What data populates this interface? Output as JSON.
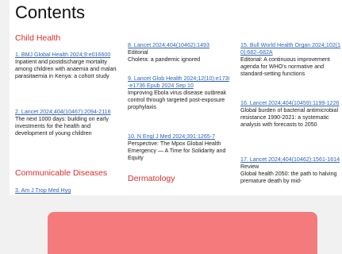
{
  "page": {
    "title": "Contents",
    "columns": [
      {
        "blocks": [
          {
            "kind": "heading",
            "text": "Child Health"
          },
          {
            "kind": "entry",
            "ref": "1. BMJ Global Health 2024;9:e016600",
            "type": "",
            "title": "Inpatient and postdischarge mortality among children with anaemia and malaria parasitaemia in Kenya: a cohort study"
          },
          {
            "kind": "entry",
            "ref": "2. Lancet 2024;404(10467):2094-2116",
            "type": "",
            "title": "The next 1000 days: building on early investments for the health and development of young children"
          },
          {
            "kind": "heading",
            "text": "Communicable Diseases"
          },
          {
            "kind": "entry",
            "ref": "3. Am J Trop Med Hyg",
            "type": "",
            "title": ""
          }
        ]
      },
      {
        "blocks": [
          {
            "kind": "entry",
            "ref": "8. Lancet 2024;404(10462):1493",
            "type": "Editorial",
            "title": "Cholera: a pandemic ignored"
          },
          {
            "kind": "entry",
            "ref": "9. Lancet Glob Health 2024;12(10):e1730-e1736 Epub 2024 Sep 10",
            "type": "",
            "title": "Improving Ebola virus disease outbreak control through targeted post-exposure prophylaxis"
          },
          {
            "kind": "entry",
            "ref": "10. N Engl J Med 2024;391:1265-7",
            "type": "",
            "title": "Perspective: The Mpox Global Health Emergency — A Time for Solidarity and Equity"
          },
          {
            "kind": "heading",
            "text": "Dermatology"
          }
        ]
      },
      {
        "blocks": [
          {
            "kind": "entry",
            "ref": "15. Bull World Health Organ 2024;102(10):682–682A",
            "type": "",
            "title": "Editorial: A continuous improvement agenda for WHO's normative and standard-setting functions"
          },
          {
            "kind": "entry",
            "ref": "16. Lancet 2024;404(10459):1199-1226",
            "type": "",
            "title": "Global burden of bacterial antimicrobial resistance 1990-2021: a systematic analysis with forecasts to 2050"
          },
          {
            "kind": "entry",
            "ref": "17. Lancet 2024;404(10462):1561-1614",
            "type": "Review",
            "title": "Global health 2050: the path to halving premature death by mid-"
          }
        ]
      }
    ]
  },
  "colors": {
    "viewer_bg": "#f1f1f1",
    "heading": "#d62d2d",
    "link": "#2f63b5",
    "box": "#f47a7c"
  }
}
